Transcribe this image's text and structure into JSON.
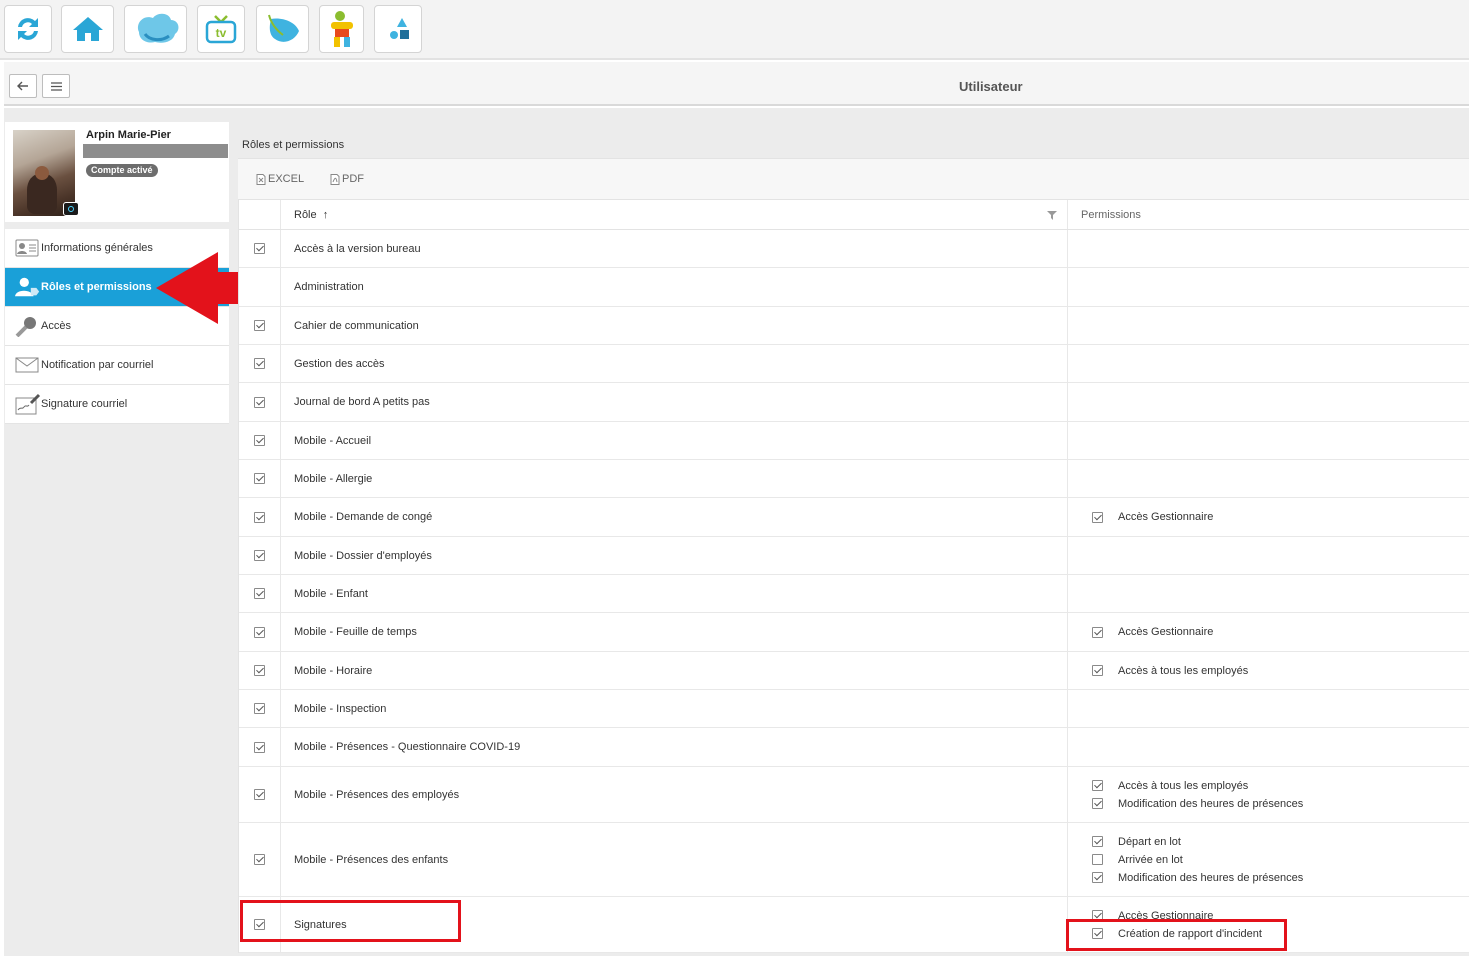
{
  "apps": [
    {
      "name": "refresh-icon"
    },
    {
      "name": "home-icon"
    },
    {
      "name": "cloud-app-icon"
    },
    {
      "name": "tv-app-icon",
      "label": "tv"
    },
    {
      "name": "leaf-app-icon"
    },
    {
      "name": "character-app-icon"
    },
    {
      "name": "shapes-app-icon"
    }
  ],
  "header": {
    "title": "Utilisateur",
    "back_icon": "arrow-left-icon",
    "menu_icon": "hamburger-icon"
  },
  "profile": {
    "name": "Arpin Marie-Pier",
    "status": "Compte activé"
  },
  "menu": [
    {
      "label": "Informations générales",
      "icon": "id-card-icon"
    },
    {
      "label": "Rôles et permissions",
      "icon": "user-roles-icon",
      "active": true
    },
    {
      "label": "Accès",
      "icon": "key-icon"
    },
    {
      "label": "Notification par courriel",
      "icon": "envelope-icon"
    },
    {
      "label": "Signature courriel",
      "icon": "signature-icon"
    }
  ],
  "section": {
    "title": "Rôles et permissions"
  },
  "toolbar": {
    "excel": "EXCEL",
    "pdf": "PDF"
  },
  "grid": {
    "col_role": "Rôle",
    "col_perm": "Permissions",
    "rows": [
      {
        "role": "Accès à la version bureau",
        "checked": true,
        "perms": []
      },
      {
        "role": "Administration",
        "checked": false,
        "perms": []
      },
      {
        "role": "Cahier de communication",
        "checked": true,
        "perms": []
      },
      {
        "role": "Gestion des accès",
        "checked": true,
        "perms": []
      },
      {
        "role": "Journal de bord A petits pas",
        "checked": true,
        "perms": []
      },
      {
        "role": "Mobile - Accueil",
        "checked": true,
        "perms": []
      },
      {
        "role": "Mobile - Allergie",
        "checked": true,
        "perms": []
      },
      {
        "role": "Mobile - Demande de congé",
        "checked": true,
        "perms": [
          {
            "label": "Accès Gestionnaire",
            "checked": true
          }
        ]
      },
      {
        "role": "Mobile - Dossier d'employés",
        "checked": true,
        "perms": []
      },
      {
        "role": "Mobile - Enfant",
        "checked": true,
        "perms": []
      },
      {
        "role": "Mobile - Feuille de temps",
        "checked": true,
        "perms": [
          {
            "label": "Accès Gestionnaire",
            "checked": true
          }
        ]
      },
      {
        "role": "Mobile - Horaire",
        "checked": true,
        "perms": [
          {
            "label": "Accès à tous les employés",
            "checked": true
          }
        ]
      },
      {
        "role": "Mobile - Inspection",
        "checked": true,
        "perms": []
      },
      {
        "role": "Mobile - Présences - Questionnaire COVID-19",
        "checked": true,
        "perms": []
      },
      {
        "role": "Mobile - Présences des employés",
        "checked": true,
        "perms": [
          {
            "label": "Accès à tous les employés",
            "checked": true
          },
          {
            "label": "Modification des heures de présences",
            "checked": true
          }
        ]
      },
      {
        "role": "Mobile - Présences des enfants",
        "checked": true,
        "perms": [
          {
            "label": "Départ en lot",
            "checked": true
          },
          {
            "label": "Arrivée en lot",
            "checked": false
          },
          {
            "label": "Modification des heures de présences",
            "checked": true
          }
        ]
      },
      {
        "role": "Signatures",
        "checked": true,
        "perms": [
          {
            "label": "Accès Gestionnaire",
            "checked": true
          },
          {
            "label": "Création de rapport d'incident",
            "checked": true
          }
        ]
      }
    ]
  }
}
